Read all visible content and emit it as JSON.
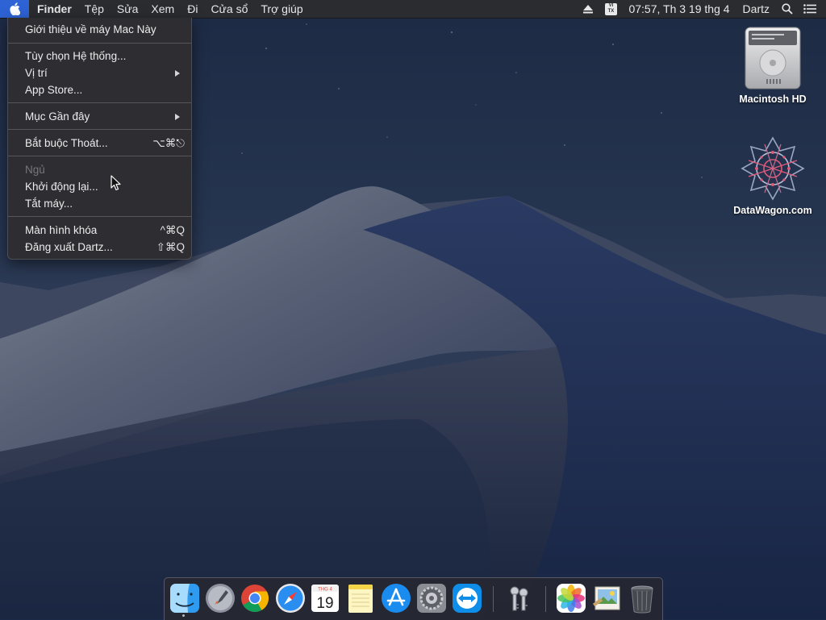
{
  "menubar": {
    "app_name": "Finder",
    "menus": [
      "Tệp",
      "Sửa",
      "Xem",
      "Đi",
      "Cửa sổ",
      "Trợ giúp"
    ],
    "input_source": [
      "VI",
      "TX"
    ],
    "clock": "07:57, Th 3 19 thg 4",
    "user": "Dartz",
    "icons": [
      "apple-icon",
      "eject-icon",
      "spotlight-search-icon",
      "notification-center-icon"
    ]
  },
  "apple_menu": {
    "items": [
      {
        "label": "Giới thiệu về máy Mac Này"
      },
      {
        "label": "Tùy chọn Hệ thống..."
      },
      {
        "label": "Vị trí",
        "submenu": true
      },
      {
        "label": "App Store..."
      },
      {
        "label": "Mục Gần đây",
        "submenu": true
      },
      {
        "label": "Bắt buộc Thoát...",
        "shortcut": "⌥⌘⎋"
      },
      {
        "label": "Ngủ",
        "disabled": true
      },
      {
        "label": "Khởi động lại..."
      },
      {
        "label": "Tắt máy..."
      },
      {
        "label": "Màn hình khóa",
        "shortcut": "^⌘Q"
      },
      {
        "label": "Đăng xuất Dartz...",
        "shortcut": "⇧⌘Q"
      }
    ]
  },
  "desktop": {
    "icons": [
      {
        "label": "Macintosh HD",
        "icon": "hard-drive-icon"
      },
      {
        "label": "DataWagon.com",
        "icon": "datawagon-logo-icon"
      }
    ]
  },
  "dock": {
    "calendar_month": "THG 4",
    "calendar_day": "19",
    "apps": [
      "finder-icon",
      "launchpad-icon",
      "chrome-icon",
      "safari-icon",
      "calendar-icon",
      "notes-icon",
      "app-store-icon",
      "system-preferences-icon",
      "teamviewer-icon",
      "keychain-access-icon",
      "photos-icon",
      "preview-icon",
      "trash-icon"
    ]
  }
}
